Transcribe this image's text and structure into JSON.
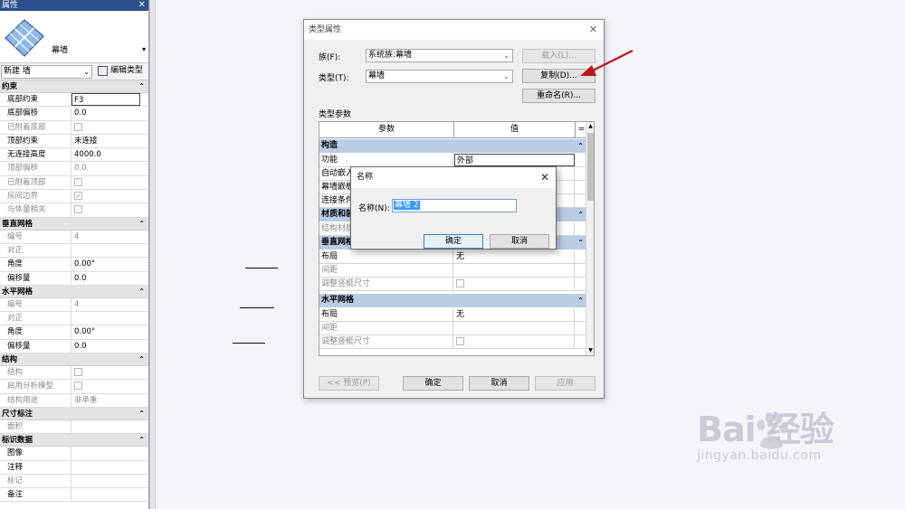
{
  "palette": {
    "title": "属性",
    "close": "✕",
    "type_name": "幕墙",
    "filter_value": "新建 墙",
    "edit_type": "编辑类型",
    "sections": [
      {
        "title": "约束",
        "rows": [
          {
            "label": "底部约束",
            "value": "F3",
            "dim": false,
            "boxed": true
          },
          {
            "label": "底部偏移",
            "value": "0.0",
            "dim": false
          },
          {
            "label": "已附着底部",
            "value": "",
            "dim": true,
            "check": true
          },
          {
            "label": "顶部约束",
            "value": "未连接",
            "dim": false
          },
          {
            "label": "无连接高度",
            "value": "4000.0",
            "dim": false
          },
          {
            "label": "顶部偏移",
            "value": "0.0",
            "dim": true
          },
          {
            "label": "已附着顶部",
            "value": "",
            "dim": true,
            "check": true
          },
          {
            "label": "房间边界",
            "value": "✓",
            "dim": true,
            "check": true
          },
          {
            "label": "与体量相关",
            "value": "",
            "dim": true,
            "check": true
          }
        ]
      },
      {
        "title": "垂直网格",
        "rows": [
          {
            "label": "编号",
            "value": "4",
            "dim": true
          },
          {
            "label": "对正",
            "value": "",
            "dim": true
          },
          {
            "label": "角度",
            "value": "0.00°",
            "dim": false
          },
          {
            "label": "偏移量",
            "value": "0.0",
            "dim": false
          }
        ]
      },
      {
        "title": "水平网格",
        "rows": [
          {
            "label": "编号",
            "value": "4",
            "dim": true
          },
          {
            "label": "对正",
            "value": "",
            "dim": true
          },
          {
            "label": "角度",
            "value": "0.00°",
            "dim": false
          },
          {
            "label": "偏移量",
            "value": "0.0",
            "dim": false
          }
        ]
      },
      {
        "title": "结构",
        "rows": [
          {
            "label": "结构",
            "value": "",
            "dim": true,
            "check": true
          },
          {
            "label": "启用分析模型",
            "value": "",
            "dim": true,
            "check": true
          },
          {
            "label": "结构用途",
            "value": "非承重",
            "dim": true
          }
        ]
      },
      {
        "title": "尺寸标注",
        "rows": [
          {
            "label": "面积",
            "value": "",
            "dim": true
          }
        ]
      },
      {
        "title": "标识数据",
        "rows": [
          {
            "label": "图像",
            "value": "",
            "dim": false
          },
          {
            "label": "注释",
            "value": "",
            "dim": false
          },
          {
            "label": "标记",
            "value": "",
            "dim": true
          },
          {
            "label": "备注",
            "value": "",
            "dim": false
          }
        ]
      }
    ]
  },
  "type_dialog": {
    "title": "类型属性",
    "family_label": "族(F):",
    "family_value": "系统族:幕墙",
    "type_label": "类型(T):",
    "type_value": "幕墙",
    "load_button": "载入(L)...",
    "duplicate_button": "复制(D)...",
    "rename_button": "重命名(R)...",
    "type_params_label": "类型参数",
    "col_param": "参数",
    "col_value": "值",
    "col_eq": "=",
    "grid": [
      {
        "kind": "sec",
        "text": "构造"
      },
      {
        "kind": "row",
        "p": "功能",
        "v": "外部",
        "edit": true
      },
      {
        "kind": "row",
        "p": "自动嵌入",
        "v": ""
      },
      {
        "kind": "row",
        "p": "幕墙嵌板",
        "v": ""
      },
      {
        "kind": "row",
        "p": "连接条件",
        "v": ""
      },
      {
        "kind": "sec",
        "text": "材质和装饰"
      },
      {
        "kind": "row",
        "p": "结构材质",
        "v": "",
        "dim": true
      },
      {
        "kind": "sec",
        "text": "垂直网格"
      },
      {
        "kind": "row",
        "p": "布局",
        "v": "无"
      },
      {
        "kind": "row",
        "p": "间距",
        "v": "",
        "dim": true
      },
      {
        "kind": "row",
        "p": "调整竖梃尺寸",
        "v": "",
        "dim": true,
        "check": true
      },
      {
        "kind": "gap"
      },
      {
        "kind": "sec",
        "text": "水平网格"
      },
      {
        "kind": "row",
        "p": "布局",
        "v": "无"
      },
      {
        "kind": "row",
        "p": "间距",
        "v": "",
        "dim": true
      },
      {
        "kind": "row",
        "p": "调整竖梃尺寸",
        "v": "",
        "dim": true,
        "check": true
      }
    ],
    "preview_button": "<< 预览(P)",
    "ok_button": "确定",
    "cancel_button": "取消",
    "apply_button": "应用"
  },
  "name_dialog": {
    "title": "名称",
    "close": "✕",
    "label": "名称(N):",
    "value": "幕墙 2",
    "ok": "确定",
    "cancel": "取消"
  },
  "watermark": {
    "brand": "Bai  经验",
    "url": "jingyan.baidu.com"
  },
  "colors": {
    "palette_title_bg": "#2b4f8a",
    "grid_section_bg": "#b9cde5",
    "selection": "#3399ff",
    "arrow": "#c0161b"
  }
}
